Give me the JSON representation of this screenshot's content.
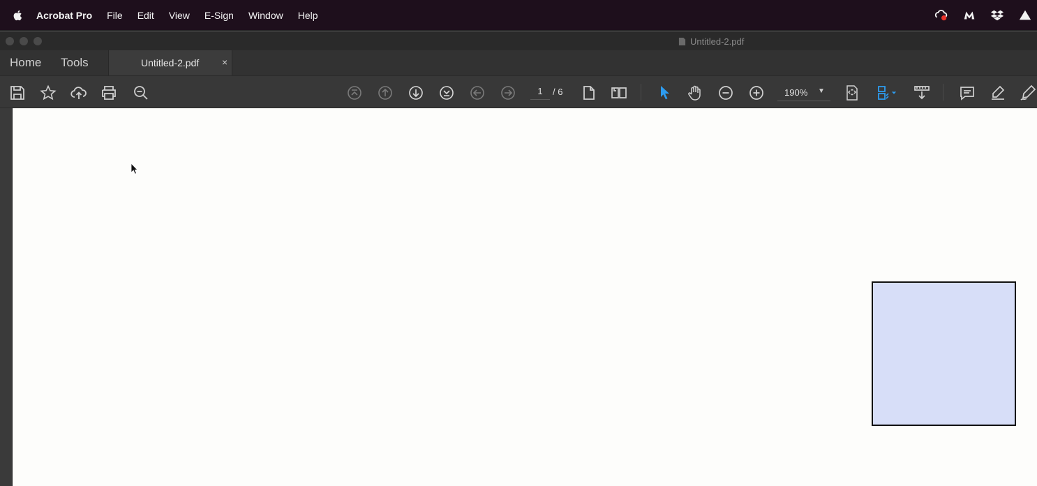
{
  "menubar": {
    "app_name": "Acrobat Pro",
    "items": [
      "File",
      "Edit",
      "View",
      "E-Sign",
      "Window",
      "Help"
    ],
    "status_icons": [
      "creative-cloud-icon",
      "malwarebytes-icon",
      "dropbox-icon",
      "google-drive-icon"
    ]
  },
  "window": {
    "title": "Untitled-2.pdf",
    "nav_tabs": {
      "home": "Home",
      "tools": "Tools"
    },
    "doc_tab": {
      "label": "Untitled-2.pdf",
      "close": "×"
    }
  },
  "toolbar": {
    "page_current": "1",
    "page_total": "/  6",
    "zoom": "190%",
    "icons": [
      "save-icon",
      "bookmark-star-icon",
      "upload-cloud-icon",
      "print-icon",
      "zoom-search-icon",
      "first-page-icon",
      "prev-page-icon",
      "next-page-icon",
      "last-page-icon",
      "back-view-icon",
      "forward-view-icon",
      "single-page-icon",
      "two-page-icon",
      "select-cursor-icon",
      "hand-tool-icon",
      "zoom-out-icon",
      "zoom-in-icon",
      "fit-page-icon",
      "scroll-mode-icon",
      "read-mode-icon",
      "comment-icon",
      "highlight-icon",
      "sign-icon"
    ],
    "accent": "#2d9cf0"
  },
  "document": {
    "shape_fill": "#d7def8",
    "shape_stroke": "#111111"
  }
}
